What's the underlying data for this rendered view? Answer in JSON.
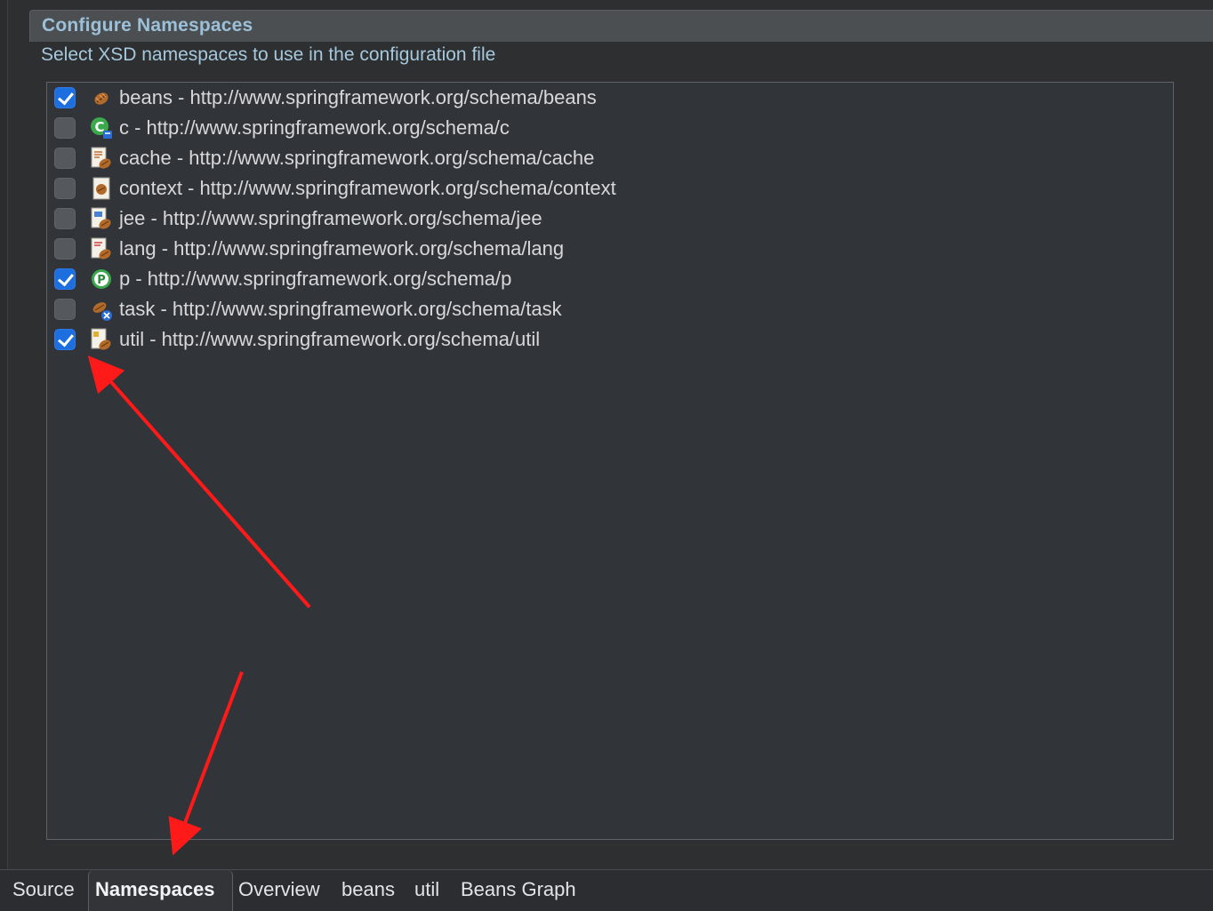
{
  "section": {
    "title": "Configure Namespaces",
    "description": "Select XSD namespaces to use in the configuration file"
  },
  "namespaces": [
    {
      "label": "beans - http://www.springframework.org/schema/beans",
      "checked": true,
      "icon": "bean-icon"
    },
    {
      "label": "c - http://www.springframework.org/schema/c",
      "checked": false,
      "icon": "c-namespace-icon"
    },
    {
      "label": "cache - http://www.springframework.org/schema/cache",
      "checked": false,
      "icon": "cache-schema-icon"
    },
    {
      "label": "context - http://www.springframework.org/schema/context",
      "checked": false,
      "icon": "context-schema-icon"
    },
    {
      "label": "jee - http://www.springframework.org/schema/jee",
      "checked": false,
      "icon": "jee-schema-icon"
    },
    {
      "label": "lang - http://www.springframework.org/schema/lang",
      "checked": false,
      "icon": "lang-schema-icon"
    },
    {
      "label": "p - http://www.springframework.org/schema/p",
      "checked": true,
      "icon": "p-namespace-icon"
    },
    {
      "label": "task - http://www.springframework.org/schema/task",
      "checked": false,
      "icon": "task-schema-icon"
    },
    {
      "label": "util - http://www.springframework.org/schema/util",
      "checked": true,
      "icon": "util-schema-icon"
    }
  ],
  "tabs": {
    "source": "Source",
    "namespaces": "Namespaces",
    "overview": "Overview",
    "beans": "beans",
    "util": "util",
    "beans_graph": "Beans Graph"
  },
  "colors": {
    "checkbox_checked": "#1d6fe0",
    "annotation_arrow": "#ff1a1a",
    "header_text": "#9cc0d8"
  }
}
